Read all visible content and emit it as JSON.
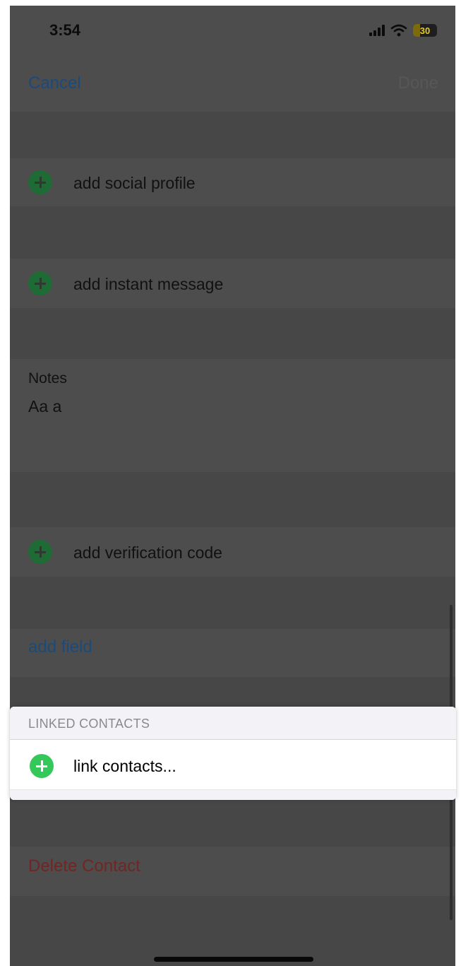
{
  "status_bar": {
    "time": "3:54",
    "battery_level": "30",
    "signal_icon": "cellular-signal-icon",
    "wifi_icon": "wifi-icon"
  },
  "nav": {
    "cancel": "Cancel",
    "done": "Done"
  },
  "rows": {
    "social_profile": "add social profile",
    "instant_message": "add instant message",
    "verification_code": "add verification code"
  },
  "notes": {
    "title": "Notes",
    "value": "Aa a"
  },
  "add_field": "add field",
  "linked_contacts": {
    "header": "LINKED CONTACTS",
    "link_label": "link contacts..."
  },
  "delete_contact": "Delete Contact",
  "colors": {
    "accent_green": "#34c759",
    "link_blue": "#1c4a79",
    "destructive_red": "#712525",
    "dim_overlay": "#4d4d4d"
  }
}
